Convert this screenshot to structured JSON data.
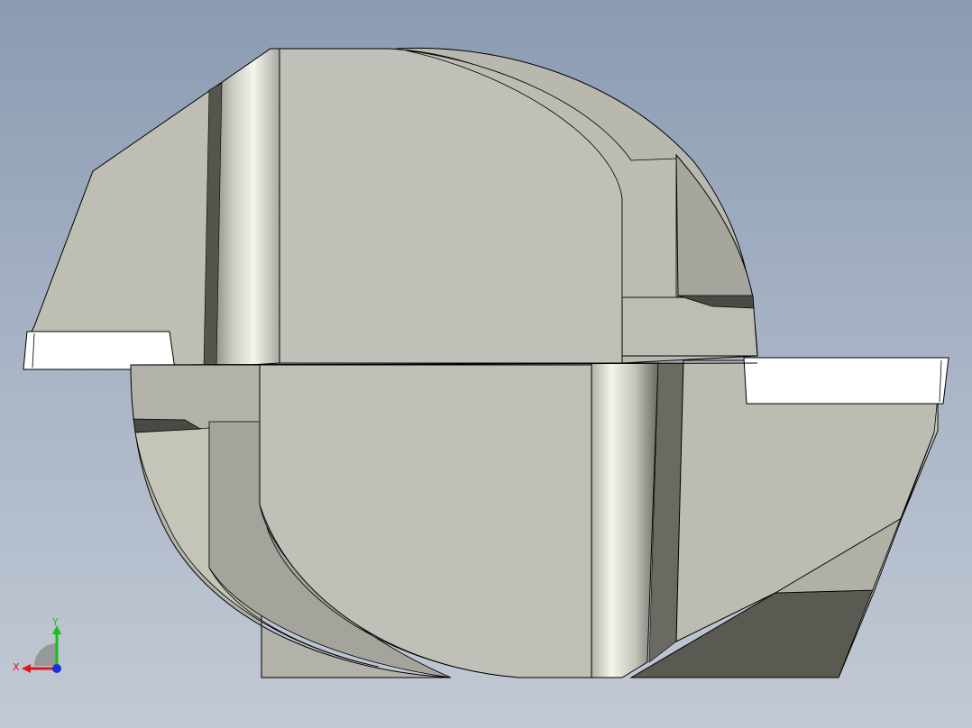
{
  "app": {
    "view_type": "3D CAD model viewport",
    "background_colors": [
      "#8a9bb2",
      "#c2c9d4"
    ]
  },
  "model": {
    "description_colors": {
      "face_light": "#c0c0b8",
      "face_mid": "#b5b5ab",
      "face_shadow": "#a3a39b",
      "face_dark": "#5a5a52",
      "insert_white": "#ffffff",
      "edge": "#000000"
    }
  },
  "triad": {
    "x_label": "X",
    "y_label": "Y",
    "x_color": "#e01818",
    "y_color": "#18c018",
    "z_color": "#1830e0"
  }
}
